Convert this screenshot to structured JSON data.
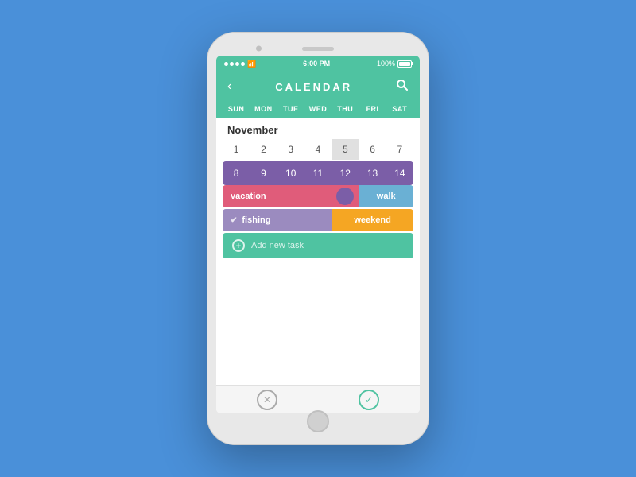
{
  "background_color": "#4a90d9",
  "phone": {
    "status_bar": {
      "dots": 4,
      "wifi": "wifi",
      "time": "6:00 PM",
      "battery_percent": "100%"
    },
    "header": {
      "back_label": "‹",
      "title": "CALENDAR",
      "search_label": "🔍"
    },
    "day_headers": [
      "SUN",
      "MON",
      "TUE",
      "WED",
      "THU",
      "FRI",
      "SAT"
    ],
    "month": "November",
    "week1": [
      "1",
      "2",
      "3",
      "4",
      "5",
      "6",
      "7"
    ],
    "week2": [
      "8",
      "9",
      "10",
      "11",
      "12",
      "13",
      "14"
    ],
    "tasks": [
      {
        "name": "vacation",
        "label": "vacation",
        "color": "#e05c7a"
      },
      {
        "name": "walk",
        "label": "walk",
        "color": "#6ab0d4"
      },
      {
        "name": "fishing",
        "label": "fishing",
        "color": "#9b8bbf"
      },
      {
        "name": "weekend",
        "label": "weekend",
        "color": "#f5a623"
      }
    ],
    "add_task_label": "Add new task",
    "bottom_nav": {
      "close_label": "✕",
      "check_label": "✓"
    }
  }
}
